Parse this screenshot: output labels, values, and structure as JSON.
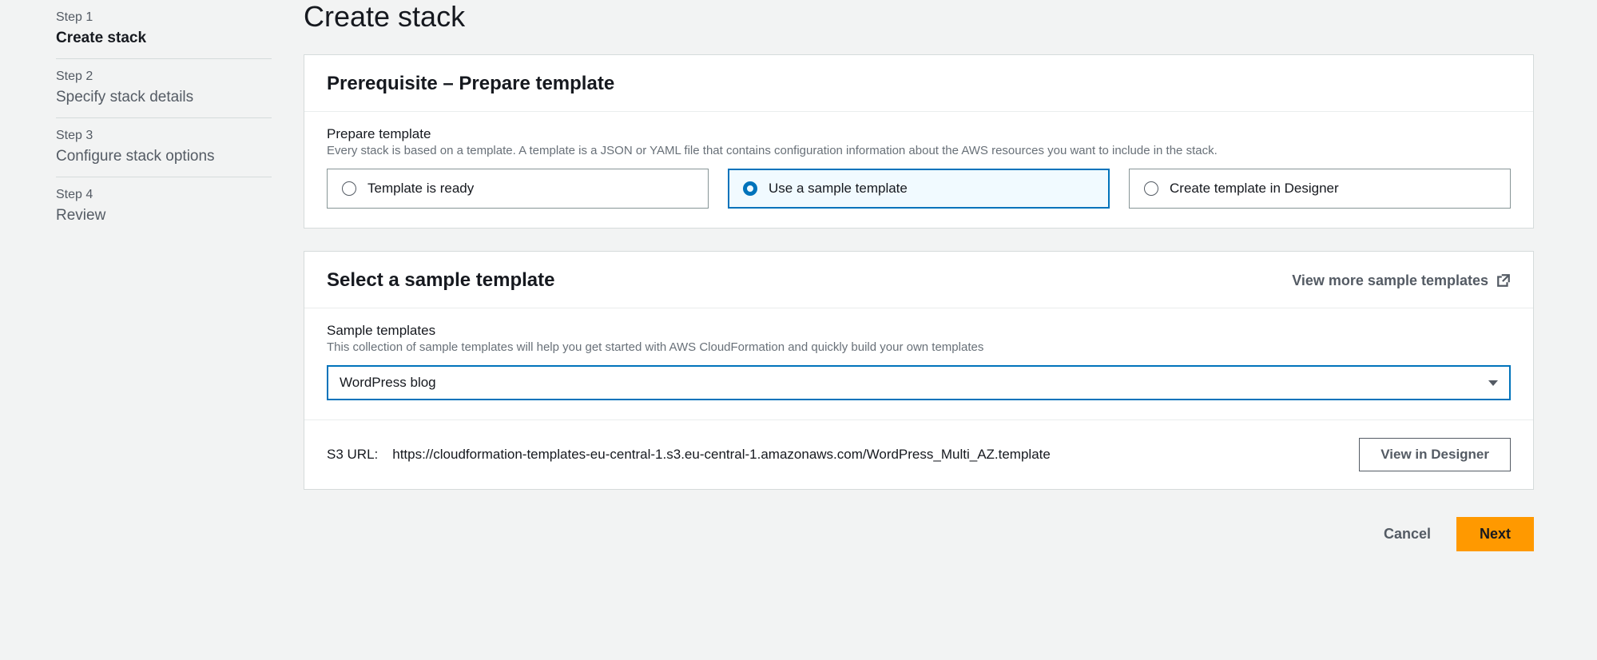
{
  "sidebar": {
    "steps": [
      {
        "label": "Step 1",
        "title": "Create stack"
      },
      {
        "label": "Step 2",
        "title": "Specify stack details"
      },
      {
        "label": "Step 3",
        "title": "Configure stack options"
      },
      {
        "label": "Step 4",
        "title": "Review"
      }
    ]
  },
  "page": {
    "title": "Create stack"
  },
  "prereq": {
    "heading": "Prerequisite – Prepare template",
    "field_label": "Prepare template",
    "field_desc": "Every stack is based on a template. A template is a JSON or YAML file that contains configuration information about the AWS resources you want to include in the stack.",
    "options": {
      "ready": "Template is ready",
      "sample": "Use a sample template",
      "designer": "Create template in Designer"
    }
  },
  "sample": {
    "heading": "Select a sample template",
    "view_more": "View more sample templates",
    "field_label": "Sample templates",
    "field_desc": "This collection of sample templates will help you get started with AWS CloudFormation and quickly build your own templates",
    "selected": "WordPress blog",
    "s3_label": "S3 URL:",
    "s3_url": "https://cloudformation-templates-eu-central-1.s3.eu-central-1.amazonaws.com/WordPress_Multi_AZ.template",
    "view_designer": "View in Designer"
  },
  "footer": {
    "cancel": "Cancel",
    "next": "Next"
  }
}
